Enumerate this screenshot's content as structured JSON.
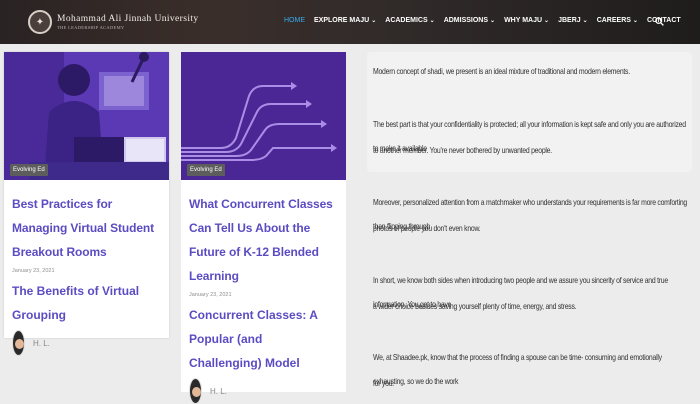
{
  "header": {
    "university_name": "Mohammad Ali Jinnah University",
    "university_tagline": "THE LEADERSHIP ACADEMY",
    "menu": [
      {
        "label": "HOME",
        "active": true,
        "dropdown": false
      },
      {
        "label": "EXPLORE MAJU",
        "active": false,
        "dropdown": true
      },
      {
        "label": "ACADEMICS",
        "active": false,
        "dropdown": true
      },
      {
        "label": "ADMISSIONS",
        "active": false,
        "dropdown": true
      },
      {
        "label": "WHY MAJU",
        "active": false,
        "dropdown": true
      },
      {
        "label": "JBERJ",
        "active": false,
        "dropdown": true
      },
      {
        "label": "CAREERS",
        "active": false,
        "dropdown": true
      },
      {
        "label": "CONTACT",
        "active": false,
        "dropdown": false
      }
    ],
    "search_icon": "search-icon",
    "accent_color": "#38a9ef"
  },
  "cards": [
    {
      "badge": "Evolving Ed",
      "title": "Best Practices for Managing Virtual Student Breakout Rooms",
      "date": "January 23, 2021",
      "related": "The Benefits of Virtual Grouping",
      "author": "H. L."
    },
    {
      "badge": "Evolving Ed",
      "title": "What Concurrent Classes Can Tell Us About the Future of K-12 Blended Learning",
      "date": "January 23, 2021",
      "related": "Concurrent Classes: A Popular (and Challenging) Model",
      "author": "H. L."
    }
  ],
  "article": {
    "p1": "Modern concept of shadi, we present is an ideal mixture of traditional and modern elements.",
    "p2a": "The best part is that your confidentiality is protected; all your information is kept safe and only you are authorized to make it available",
    "p2b": "to another member. You're never bothered by unwanted people.",
    "p3a": "Moreover, personalized attention from a matchmaker who understands your requirements is far more comforting than flipping through",
    "p3b": "photos of people you don't even know.",
    "p4a": "In short, we know both sides when introducing two people and we assure you sincerity of service and true information. You get to have",
    "p4b": "a wider choice besides saving yourself plenty of time, energy, and stress.",
    "p5a": "We, at Shaadee.pk, know that the process of finding a spouse can be time- consuming and emotionally exhausting, so we do the work",
    "p5b": "for you."
  },
  "colors": {
    "purple_title": "#5a4cc2",
    "card_image_purple": "#5533a8"
  }
}
